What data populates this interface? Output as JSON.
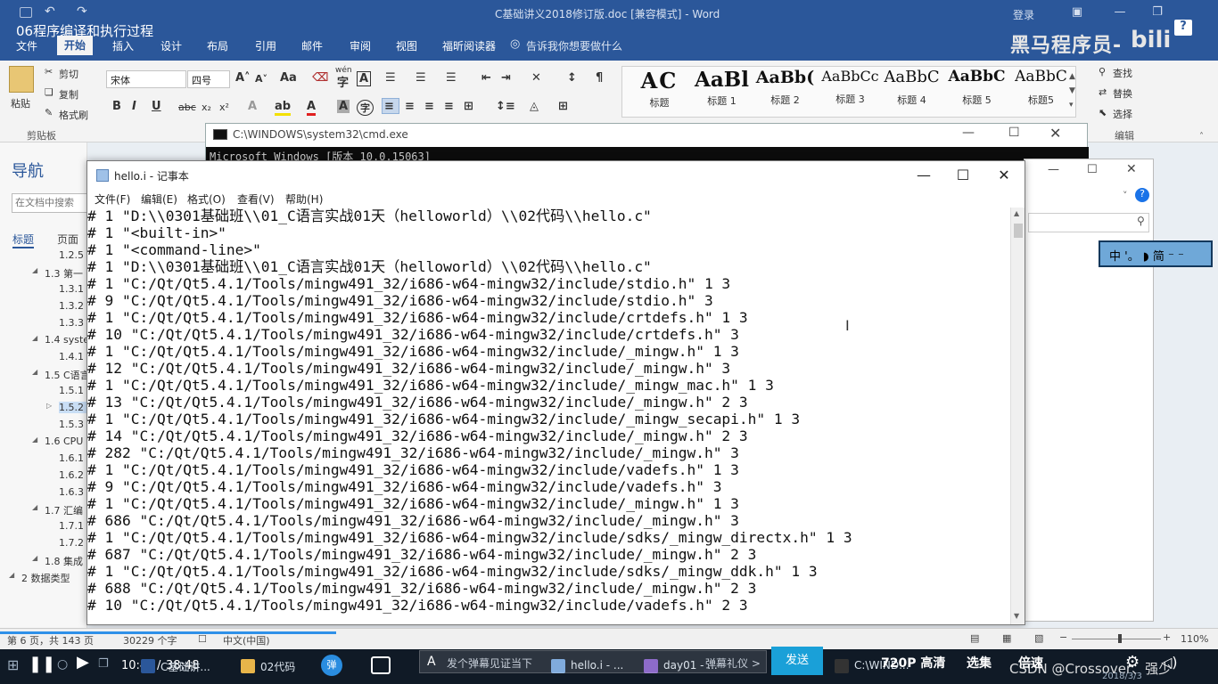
{
  "video": {
    "title": "06程序编译和执行过程"
  },
  "word": {
    "doc_title": "C基础讲义2018修订版.doc [兼容模式] - Word",
    "login": "登录",
    "tabs": [
      "文件",
      "开始",
      "插入",
      "设计",
      "布局",
      "引用",
      "邮件",
      "审阅",
      "视图",
      "福昕阅读器"
    ],
    "active_tab": "开始",
    "tellme": "告诉我你想要做什么",
    "brand": "黑马程序员-",
    "bili": "bili",
    "ribbon": {
      "clipboard": {
        "paste": "粘贴",
        "cut": "剪切",
        "copy": "复制",
        "format_painter": "格式刷",
        "group": "剪贴板"
      },
      "font": {
        "name": "宋体",
        "size": "四号",
        "case": "Aa",
        "phonetic": "wén",
        "border_char": "A"
      },
      "styles": [
        {
          "sample": "AC",
          "name": "标题"
        },
        {
          "sample": "AaBl",
          "name": "标题 1"
        },
        {
          "sample": "AaBb(",
          "name": "标题 2"
        },
        {
          "sample": "AaBbCc",
          "name": "标题 3"
        },
        {
          "sample": "AaBbC",
          "name": "标题 4"
        },
        {
          "sample": "AaBbC",
          "name": "标题 5"
        },
        {
          "sample": "AaBbC",
          "name": "标题5"
        }
      ],
      "editing": {
        "find": "查找",
        "replace": "替换",
        "select": "选择",
        "group": "编辑"
      }
    },
    "nav": {
      "title": "导航",
      "search_placeholder": "在文档中搜索",
      "tabs": [
        "标题",
        "页面"
      ],
      "items": [
        {
          "text": "1.2.5",
          "level": 3
        },
        {
          "text": "1.3 第一",
          "level": 2
        },
        {
          "text": "1.3.1",
          "level": 3
        },
        {
          "text": "1.3.2",
          "level": 3
        },
        {
          "text": "1.3.3",
          "level": 3
        },
        {
          "text": "1.4 syste",
          "level": 2
        },
        {
          "text": "1.4.1",
          "level": 3
        },
        {
          "text": "1.5 C语言",
          "level": 2
        },
        {
          "text": "1.5.1",
          "level": 3
        },
        {
          "text": "1.5.2",
          "level": 3,
          "selected": true
        },
        {
          "text": "1.5.3",
          "level": 3
        },
        {
          "text": "1.6 CPU",
          "level": 2
        },
        {
          "text": "1.6.1",
          "level": 3
        },
        {
          "text": "1.6.2",
          "level": 3
        },
        {
          "text": "1.6.3",
          "level": 3
        },
        {
          "text": "1.7 汇编",
          "level": 2
        },
        {
          "text": "1.7.1",
          "level": 3
        },
        {
          "text": "1.7.2",
          "level": 3
        },
        {
          "text": "1.8 集成",
          "level": 2
        },
        {
          "text": "2 数据类型",
          "level": 1
        }
      ]
    },
    "status": {
      "page": "第 6 页，共 143 页",
      "words": "30229 个字",
      "lang": "中文(中国)",
      "zoom": "110%"
    }
  },
  "cmd": {
    "title": "C:\\WINDOWS\\system32\\cmd.exe",
    "line": "Microsoft Windows [版本 10.0.15063]"
  },
  "ime": {
    "label": "中 '。 ◗ 简 ⁻ ⁻"
  },
  "notepad": {
    "title": "hello.i - 记事本",
    "menu": [
      "文件(F)",
      "编辑(E)",
      "格式(O)",
      "查看(V)",
      "帮助(H)"
    ],
    "lines": [
      "# 1 \"D:\\\\0301基础班\\\\01_C语言实战01天（helloworld）\\\\02代码\\\\hello.c\"",
      "# 1 \"<built-in>\"",
      "# 1 \"<command-line>\"",
      "# 1 \"D:\\\\0301基础班\\\\01_C语言实战01天（helloworld）\\\\02代码\\\\hello.c\"",
      "# 1 \"C:/Qt/Qt5.4.1/Tools/mingw491_32/i686-w64-mingw32/include/stdio.h\" 1 3",
      "# 9 \"C:/Qt/Qt5.4.1/Tools/mingw491_32/i686-w64-mingw32/include/stdio.h\" 3",
      "# 1 \"C:/Qt/Qt5.4.1/Tools/mingw491_32/i686-w64-mingw32/include/crtdefs.h\" 1 3",
      "# 10 \"C:/Qt/Qt5.4.1/Tools/mingw491_32/i686-w64-mingw32/include/crtdefs.h\" 3",
      "# 1 \"C:/Qt/Qt5.4.1/Tools/mingw491_32/i686-w64-mingw32/include/_mingw.h\" 1 3",
      "# 12 \"C:/Qt/Qt5.4.1/Tools/mingw491_32/i686-w64-mingw32/include/_mingw.h\" 3",
      "# 1 \"C:/Qt/Qt5.4.1/Tools/mingw491_32/i686-w64-mingw32/include/_mingw_mac.h\" 1 3",
      "# 13 \"C:/Qt/Qt5.4.1/Tools/mingw491_32/i686-w64-mingw32/include/_mingw.h\" 2 3",
      "# 1 \"C:/Qt/Qt5.4.1/Tools/mingw491_32/i686-w64-mingw32/include/_mingw_secapi.h\" 1 3",
      "# 14 \"C:/Qt/Qt5.4.1/Tools/mingw491_32/i686-w64-mingw32/include/_mingw.h\" 2 3",
      "# 282 \"C:/Qt/Qt5.4.1/Tools/mingw491_32/i686-w64-mingw32/include/_mingw.h\" 3",
      "# 1 \"C:/Qt/Qt5.4.1/Tools/mingw491_32/i686-w64-mingw32/include/vadefs.h\" 1 3",
      "# 9 \"C:/Qt/Qt5.4.1/Tools/mingw491_32/i686-w64-mingw32/include/vadefs.h\" 3",
      "# 1 \"C:/Qt/Qt5.4.1/Tools/mingw491_32/i686-w64-mingw32/include/_mingw.h\" 1 3",
      "# 686 \"C:/Qt/Qt5.4.1/Tools/mingw491_32/i686-w64-mingw32/include/_mingw.h\" 3",
      "# 1 \"C:/Qt/Qt5.4.1/Tools/mingw491_32/i686-w64-mingw32/include/sdks/_mingw_directx.h\" 1 3",
      "# 687 \"C:/Qt/Qt5.4.1/Tools/mingw491_32/i686-w64-mingw32/include/_mingw.h\" 2 3",
      "# 1 \"C:/Qt/Qt5.4.1/Tools/mingw491_32/i686-w64-mingw32/include/sdks/_mingw_ddk.h\" 1 3",
      "# 688 \"C:/Qt/Qt5.4.1/Tools/mingw491_32/i686-w64-mingw32/include/_mingw.h\" 2 3",
      "# 10 \"C:/Qt/Qt5.4.1/Tools/mingw491_32/i686-w64-mingw32/include/vadefs.h\" 2 3"
    ]
  },
  "player": {
    "time_current": "10:41",
    "time_total": "38:48",
    "danmu_placeholder": "发个弹幕见证当下",
    "danmu_etiquette": "弹幕礼仪 >",
    "send": "发送",
    "quality": "720P 高清",
    "episodes": "选集",
    "speed": "倍速",
    "watermark": "CSDN @Crossover、强少",
    "date": "2018/3/3",
    "progress_fraction": 0.2757,
    "taskbar": [
      {
        "label": "C基础讲...",
        "color": "#2b579a"
      },
      {
        "label": "02代码",
        "color": "#e8b54a"
      },
      {
        "label": "hello.i - ...",
        "color": "#6fa0d8"
      },
      {
        "label": "day01 - ...",
        "color": "#7e57c2"
      },
      {
        "label": "C:\\WIND...",
        "color": "#333333"
      }
    ]
  }
}
